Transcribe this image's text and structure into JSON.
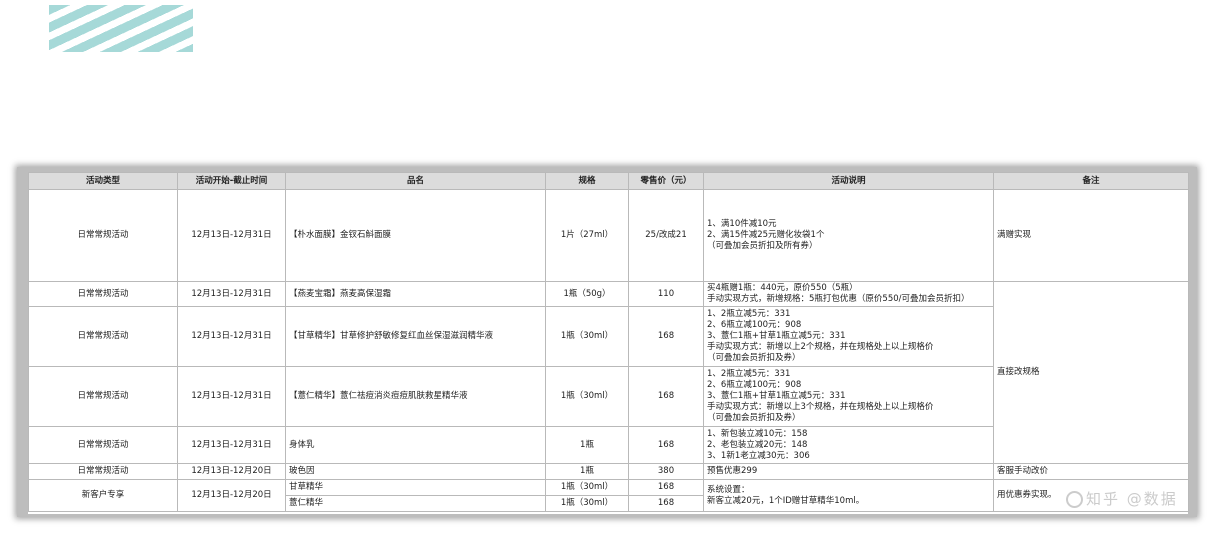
{
  "table": {
    "headers": [
      "活动类型",
      "活动开始-截止时间",
      "品名",
      "规格",
      "零售价（元）",
      "活动说明",
      "备注"
    ],
    "rows": [
      {
        "type": "日常常规活动",
        "period": "12月13日-12月31日",
        "name": "【朴水面膜】金钗石斛面膜",
        "spec": "1片（27ml）",
        "price": "25/改成21",
        "desc": "1、满10件减10元\n2、满15件减25元赠化妆袋1个\n（可叠加会员折扣及所有券）",
        "note": "满赠实现"
      },
      {
        "type": "日常常规活动",
        "period": "12月13日-12月31日",
        "name": "【燕麦宝霜】燕麦高保湿霜",
        "spec": "1瓶（50g）",
        "price": "110",
        "desc": "买4瓶赠1瓶：440元，原价550（5瓶）\n手动实现方式，新增规格：5瓶打包优惠（原价550/可叠加会员折扣）"
      },
      {
        "type": "日常常规活动",
        "period": "12月13日-12月31日",
        "name": "【甘草精华】甘草修护舒敏修复红血丝保湿滋润精华液",
        "spec": "1瓶（30ml）",
        "price": "168",
        "desc": "1、2瓶立减5元：331\n2、6瓶立减100元：908\n3、薏仁1瓶+甘草1瓶立减5元：331\n手动实现方式：新增以上2个规格，并在规格处上以上规格价\n（可叠加会员折扣及券）"
      },
      {
        "type": "日常常规活动",
        "period": "12月13日-12月31日",
        "name": "【薏仁精华】薏仁祛痘消炎痘痘肌肤救星精华液",
        "spec": "1瓶（30ml）",
        "price": "168",
        "desc": "1、2瓶立减5元：331\n2、6瓶立减100元：908\n3、薏仁1瓶+甘草1瓶立减5元：331\n手动实现方式：新增以上3个规格，并在规格处上以上规格价\n（可叠加会员折扣及券）"
      },
      {
        "type": "日常常规活动",
        "period": "12月13日-12月31日",
        "name": "身体乳",
        "spec": "1瓶",
        "price": "168",
        "desc": "1、新包装立减10元：158\n2、老包装立减20元：148\n3、1新1老立减30元：306"
      },
      {
        "type": "日常常规活动",
        "period": "12月13日-12月20日",
        "name": "玻色因",
        "spec": "1瓶",
        "price": "380",
        "desc": "预售优惠299",
        "note": "客服手动改价"
      }
    ],
    "shared_note": "直接改规格",
    "last_group": {
      "type": "新客户专享",
      "period": "12月13日-12月20日",
      "items": [
        {
          "name": "甘草精华",
          "spec": "1瓶（30ml）",
          "price": "168"
        },
        {
          "name": "薏仁精华",
          "spec": "1瓶（30ml）",
          "price": "168"
        }
      ],
      "desc": "系统设置：\n新客立减20元，1个ID赠甘草精华10ml。",
      "note": "用优惠券实现。"
    }
  },
  "watermark": "知乎 @数据"
}
